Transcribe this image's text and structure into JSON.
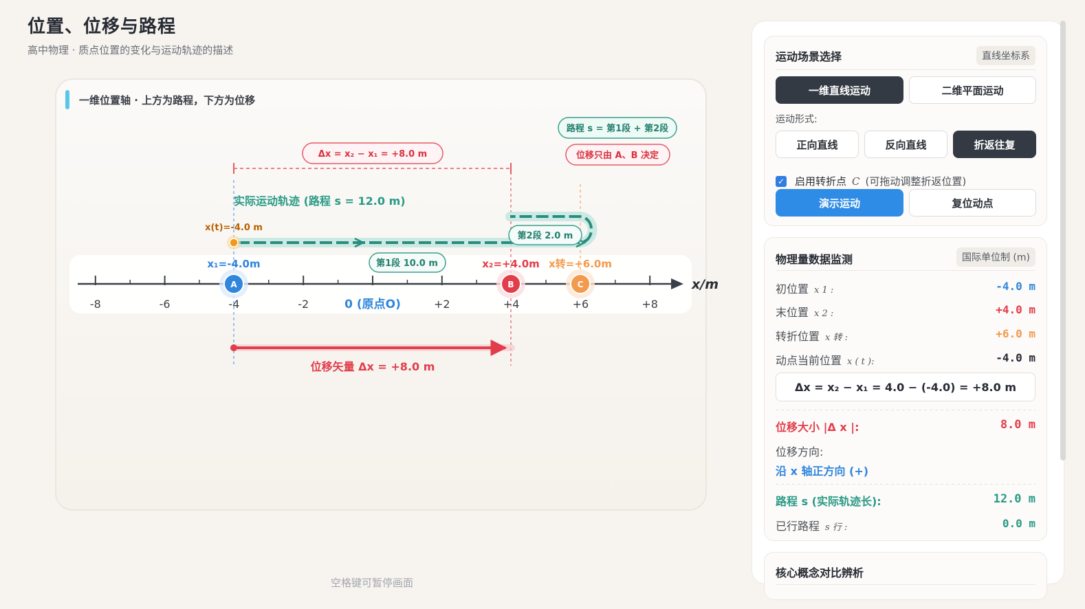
{
  "header": {
    "title": "位置、位移与路程",
    "subtitle": "高中物理 · 质点位置的变化与运动轨迹的描述"
  },
  "canvas": {
    "label": "一维位置轴 · 上方为路程，下方为位移",
    "axis_unit": "x/m",
    "ticks": [
      "-8",
      "-6",
      "-4",
      "-2",
      "0 (原点O)",
      "+2",
      "+4",
      "+6",
      "+8"
    ],
    "annotations": {
      "path_formula": "路程 s = 第1段 + 第2段",
      "displacement_only": "位移只由 A、B 决定",
      "delta_formula": "Δx = x₂ − x₁ = +8.0 m",
      "trajectory_label": "实际运动轨迹 (路程 s = 12.0 m)",
      "moving_point": "x(t)=-4.0 m",
      "segment2": "第2段 2.0 m",
      "segment1": "第1段 10.0 m",
      "x1": "x₁=-4.0m",
      "x2": "x₂=+4.0m",
      "xturn": "x转=+6.0m",
      "displacement_vector": "位移矢量 Δx = +8.0 m"
    },
    "points": {
      "A": "A",
      "B": "B",
      "C": "C"
    },
    "pause_hint": "空格键可暂停画面"
  },
  "colors": {
    "displacement": "#e23d4b",
    "path": "#2a8c7c",
    "start": "#2f86dc",
    "turn": "#f39a4d",
    "moving": "#f29a18"
  },
  "scene_panel": {
    "title": "运动场景选择",
    "tag": "直线坐标系",
    "mode_buttons": [
      "一维直线运动",
      "二维平面运动"
    ],
    "active_mode": "一维直线运动",
    "form_label": "运动形式:",
    "form_buttons": [
      "正向直线",
      "反向直线",
      "折返往复"
    ],
    "active_form": "折返往复",
    "checkbox": {
      "checked": true,
      "label": "启用转折点",
      "symbol": "C",
      "note": "(可拖动调整折返位置)"
    },
    "play_button": "演示运动",
    "reset_button": "复位动点"
  },
  "data_panel": {
    "title": "物理量数据监测",
    "tag": "国际单位制 (m)",
    "rows": [
      {
        "label": "初位置",
        "symbol": "x 1 :",
        "value": "-4.0 m"
      },
      {
        "label": "末位置",
        "symbol": "x 2 :",
        "value": "+4.0 m"
      },
      {
        "label": "转折位置",
        "symbol": "x 转 :",
        "value": "+6.0 m"
      },
      {
        "label": "动点当前位置",
        "symbol": "x ( t ):",
        "value": "-4.0 m"
      }
    ],
    "formula": "Δx = x₂ − x₁ = 4.0 − (-4.0) = +8.0 m",
    "displacement_size_label": "位移大小 |Δ x |:",
    "displacement_size_value": "8.0 m",
    "direction_label": "位移方向:",
    "direction_value": "沿 x 轴正方向 (+)",
    "path_label": "路程 s (实际轨迹长):",
    "path_value": "12.0 m",
    "travelled_label": "已行路程",
    "travelled_symbol": "s 行 :",
    "travelled_value": "0.0 m"
  },
  "concept_panel": {
    "title": "核心概念对比辨析"
  }
}
